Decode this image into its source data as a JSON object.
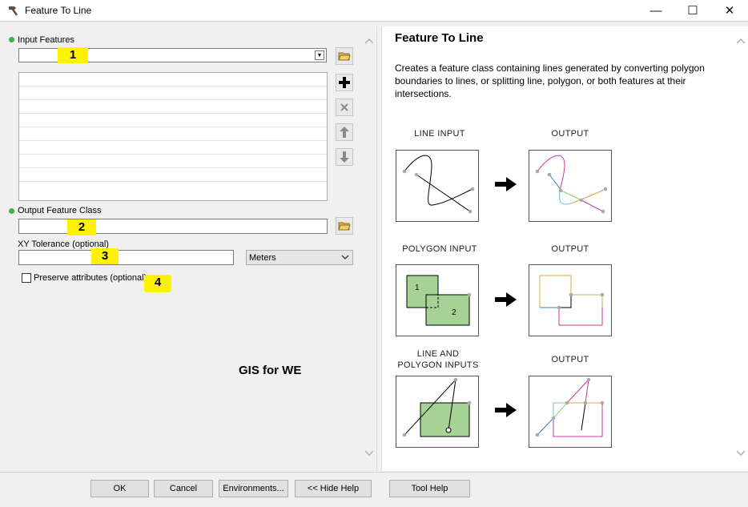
{
  "window": {
    "title": "Feature To Line",
    "icon": "hammer-icon",
    "controls": {
      "minimize": "—",
      "maximize": "☐",
      "close": "✕"
    }
  },
  "form": {
    "input_features_label": "Input Features",
    "input_features_value": "",
    "output_class_label": "Output Feature Class",
    "output_class_value": "",
    "xy_tolerance_label": "XY Tolerance (optional)",
    "xy_tolerance_value": "",
    "units_value": "Meters",
    "preserve_label": "Preserve attributes (optional)",
    "preserve_checked": false
  },
  "annotations": {
    "a1": "1",
    "a2": "2",
    "a3": "3",
    "a4": "4",
    "watermark": "GIS for WE"
  },
  "help": {
    "title": "Feature To Line",
    "description": "Creates a feature class containing lines generated by converting polygon boundaries to lines, or splitting line, polygon, or both features at their intersections.",
    "diagrams": {
      "line_input": "LINE INPUT",
      "polygon_input": "POLYGON INPUT",
      "line_polygon_input": "LINE AND POLYGON INPUTS",
      "output": "OUTPUT",
      "poly_label_1": "1",
      "poly_label_2": "2"
    }
  },
  "buttons": {
    "ok": "OK",
    "cancel": "Cancel",
    "environments": "Environments...",
    "hide_help": "<< Hide Help",
    "tool_help": "Tool Help"
  },
  "colors": {
    "annotation_highlight": "#fff200",
    "required_dot": "#37b24d",
    "polygon_fill": "#a6d395"
  }
}
